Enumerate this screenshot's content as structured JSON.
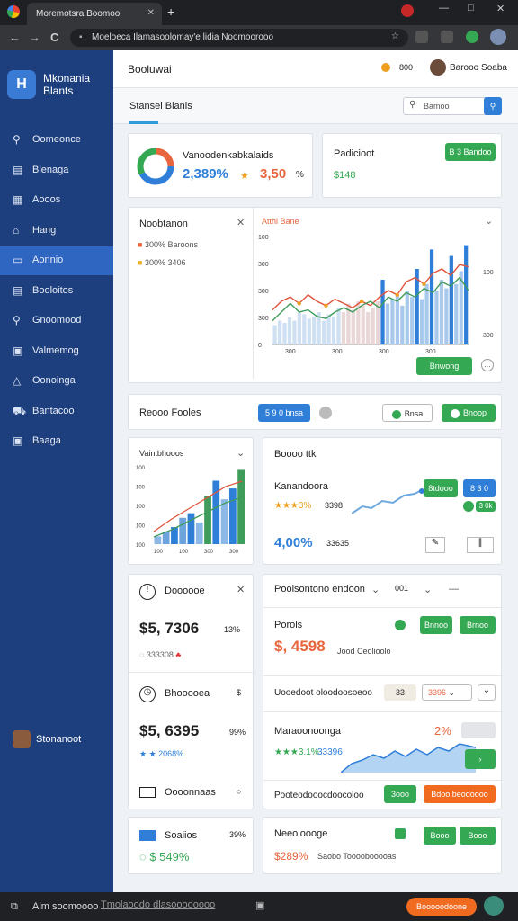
{
  "browser": {
    "tab_title": "Moremotsra Boomoo",
    "address": "Moeloeca Ilamasoolomay'e lidia Noomoorooo",
    "new_tab": "+",
    "buttons": {
      "back": "←",
      "forward": "→",
      "reload": "C",
      "minimize": "—",
      "maximize": "□",
      "close": "✕",
      "star": "☆",
      "lock": "🔒"
    }
  },
  "sidebar": {
    "logo_letter": "H",
    "brand": "Mkonania Blants",
    "items": [
      {
        "label": "Oomeonce",
        "icon": "⚲"
      },
      {
        "label": "Blenaga",
        "icon": "▤"
      },
      {
        "label": "Aooos",
        "icon": "▦"
      },
      {
        "label": "Hang",
        "icon": "⌂"
      },
      {
        "label": "Aonnio",
        "icon": "▭"
      },
      {
        "label": "Booloitos",
        "icon": "▤"
      },
      {
        "label": "Gnoomood",
        "icon": "⚲"
      },
      {
        "label": "Valmemog",
        "icon": "▣"
      },
      {
        "label": "Oonoinga",
        "icon": "△"
      },
      {
        "label": "Bantacoo",
        "icon": "⛟"
      },
      {
        "label": "Baaga",
        "icon": "▣"
      }
    ],
    "user": "Stonanoot"
  },
  "header": {
    "title": "Booluwai",
    "badge": "800",
    "user": "Barooo Soaba"
  },
  "subheader": {
    "tab": "Stansel Blanis",
    "search_placeholder": "Bamoo"
  },
  "kpi1": {
    "title": "Vanoodenkabkalaids",
    "value": "2,389%",
    "value2": "3,50",
    "extra": "%"
  },
  "kpi2": {
    "title": "Padicioot",
    "button": "B 3 Bandoo",
    "value": "$148"
  },
  "chart_panel": {
    "title": "Noobtanon",
    "legend": [
      {
        "text": "300% Baroons",
        "color": "#e8663d"
      },
      {
        "text": "300% 3406",
        "color": "#e6b323"
      }
    ],
    "chart_title": "Atthl Bane",
    "yticks": [
      "100",
      "300",
      "300",
      "300",
      "0"
    ],
    "xticks": [
      "300",
      "300",
      "300",
      "300"
    ],
    "right_ticks": [
      "100",
      "300"
    ],
    "button": "Bnwong"
  },
  "toolbar2": {
    "title": "Reooo Fooles",
    "btn1": "5 9 0 bnsa",
    "btn2": "Bnsa",
    "btn3": "Bnoop"
  },
  "mini_chart": {
    "title": "Vaintbhooos",
    "yticks": [
      "100",
      "100",
      "100",
      "100",
      "100"
    ],
    "xticks": [
      "100",
      "100",
      "300",
      "300"
    ]
  },
  "stat_card": {
    "title": "Boooo ttk",
    "subtitle": "Kanandoora",
    "rating": "★★★3%",
    "rating_val": "3398",
    "btn1": "8tdooo",
    "btn2": "8 3 0",
    "btn3": "3 0k",
    "pct": "4,00%",
    "pct_val": "33635"
  },
  "card_left1": {
    "title": "Doooooe",
    "value": "$5, 7306",
    "pct": "13%",
    "sub": "333308"
  },
  "card_left2": {
    "title": "Bhooooea",
    "value": "$5, 6395",
    "pct": "99%",
    "sub": "2068%"
  },
  "card_left3": {
    "title": "Oooonnaas"
  },
  "right_panel": {
    "title": "Poolsontono endoon",
    "sub": "001",
    "p1_title": "Porols",
    "p1_value": "$, 4598",
    "p1_note": "Jood Ceolioolo",
    "p1_btn1": "Bnnoo",
    "p1_btn2": "Brnoo",
    "row_text": "Uooedoot oloodoosoeoo",
    "row_chip": "33",
    "row_val": "3396",
    "p2_title": "Maraoonoonga",
    "p2_pct": "2%",
    "p2_rating": "★★★3.1%",
    "p2_val": "33396",
    "footer": "Pooteodooocdoocoloo",
    "footer_btn1": "3ooo",
    "footer_btn2": "Bdoo beodoooo"
  },
  "card_left4": {
    "title": "Soaiios",
    "pct": "39%",
    "value": "$ 549%"
  },
  "card_right4": {
    "title": "Neeoloooge",
    "value": "$289%",
    "note": "Saobo Toooobooooas",
    "btn1": "Booo",
    "btn2": "Booo"
  },
  "bottombar": {
    "left": "Alm soomoooo",
    "middle": "Tmolaoodo dlasoooooooo",
    "btn": "Booooodoone"
  },
  "colors": {
    "sidebar": "#1e3f7d",
    "active": "#2f66c2",
    "green": "#34a853",
    "blue": "#2f7fd9",
    "orange": "#f06a20"
  }
}
